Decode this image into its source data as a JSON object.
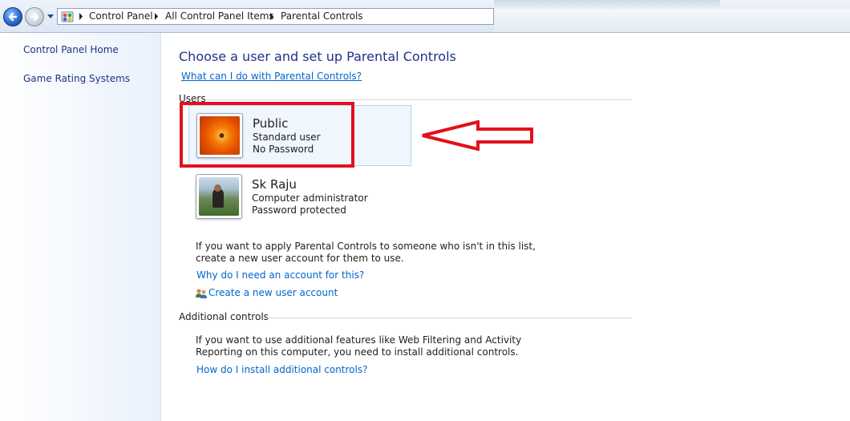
{
  "breadcrumb": {
    "items": [
      "Control Panel",
      "All Control Panel Items",
      "Parental Controls"
    ]
  },
  "icons": {
    "back": "back-arrow-icon",
    "forward": "forward-arrow-icon",
    "recent_pages": "chevron-down-icon",
    "address": "control-panel-icon",
    "create_account": "users-icon"
  },
  "sidebar": {
    "items": [
      {
        "label": "Control Panel Home"
      },
      {
        "label": "Game Rating Systems"
      }
    ]
  },
  "main": {
    "title": "Choose a user and set up Parental Controls",
    "help_link": "What can I do with Parental Controls?",
    "users_section": {
      "label": "Users",
      "users": [
        {
          "name": "Public",
          "type": "Standard user",
          "password": "No Password",
          "selected": true
        },
        {
          "name": "Sk Raju",
          "type": "Computer administrator",
          "password": "Password protected",
          "selected": false
        }
      ]
    },
    "new_account": {
      "text_line1": "If you want to apply Parental Controls to someone who isn't in this list,",
      "text_line2": "create a new user account for them to use.",
      "why_link": "Why do I need an account for this?",
      "create_link": "Create a new user account"
    },
    "additional": {
      "label": "Additional controls",
      "text_line1": "If you want to use additional features like Web Filtering and Activity",
      "text_line2": "Reporting on this computer, you need to install additional controls.",
      "install_link": "How do I install additional controls?"
    }
  },
  "annotation": {
    "box_color": "#e3101b",
    "arrow_color": "#e3101b"
  },
  "colors": {
    "title": "#1e3287",
    "link": "#0066cc",
    "sidebar_link": "#1e3287"
  }
}
